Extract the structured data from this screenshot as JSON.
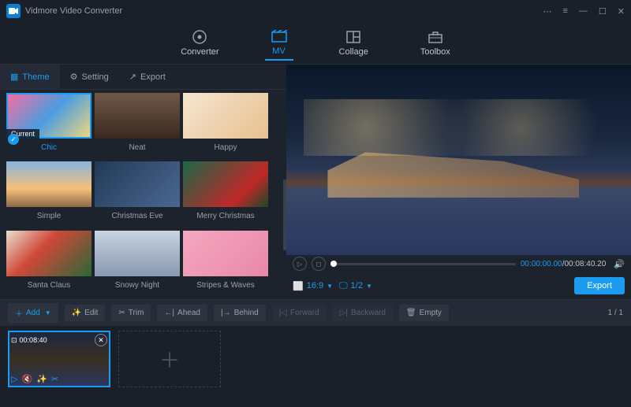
{
  "app": {
    "title": "Vidmore Video Converter"
  },
  "nav": {
    "converter": "Converter",
    "mv": "MV",
    "collage": "Collage",
    "toolbox": "Toolbox"
  },
  "subtabs": {
    "theme": "Theme",
    "setting": "Setting",
    "export": "Export"
  },
  "themes": {
    "current_label": "Current",
    "items": [
      {
        "name": "Chic"
      },
      {
        "name": "Neat"
      },
      {
        "name": "Happy"
      },
      {
        "name": "Simple"
      },
      {
        "name": "Christmas Eve"
      },
      {
        "name": "Merry Christmas"
      },
      {
        "name": "Santa Claus"
      },
      {
        "name": "Snowy Night"
      },
      {
        "name": "Stripes & Waves"
      }
    ]
  },
  "preview": {
    "time_current": "00:00:00.00",
    "time_total": "00:08:40.20",
    "aspect": "16:9",
    "display": "1/2",
    "export": "Export"
  },
  "toolbar": {
    "add": "Add",
    "edit": "Edit",
    "trim": "Trim",
    "ahead": "Ahead",
    "behind": "Behind",
    "forward": "Forward",
    "backward": "Backward",
    "empty": "Empty",
    "page": "1 / 1"
  },
  "clip": {
    "duration": "00:08:40"
  }
}
